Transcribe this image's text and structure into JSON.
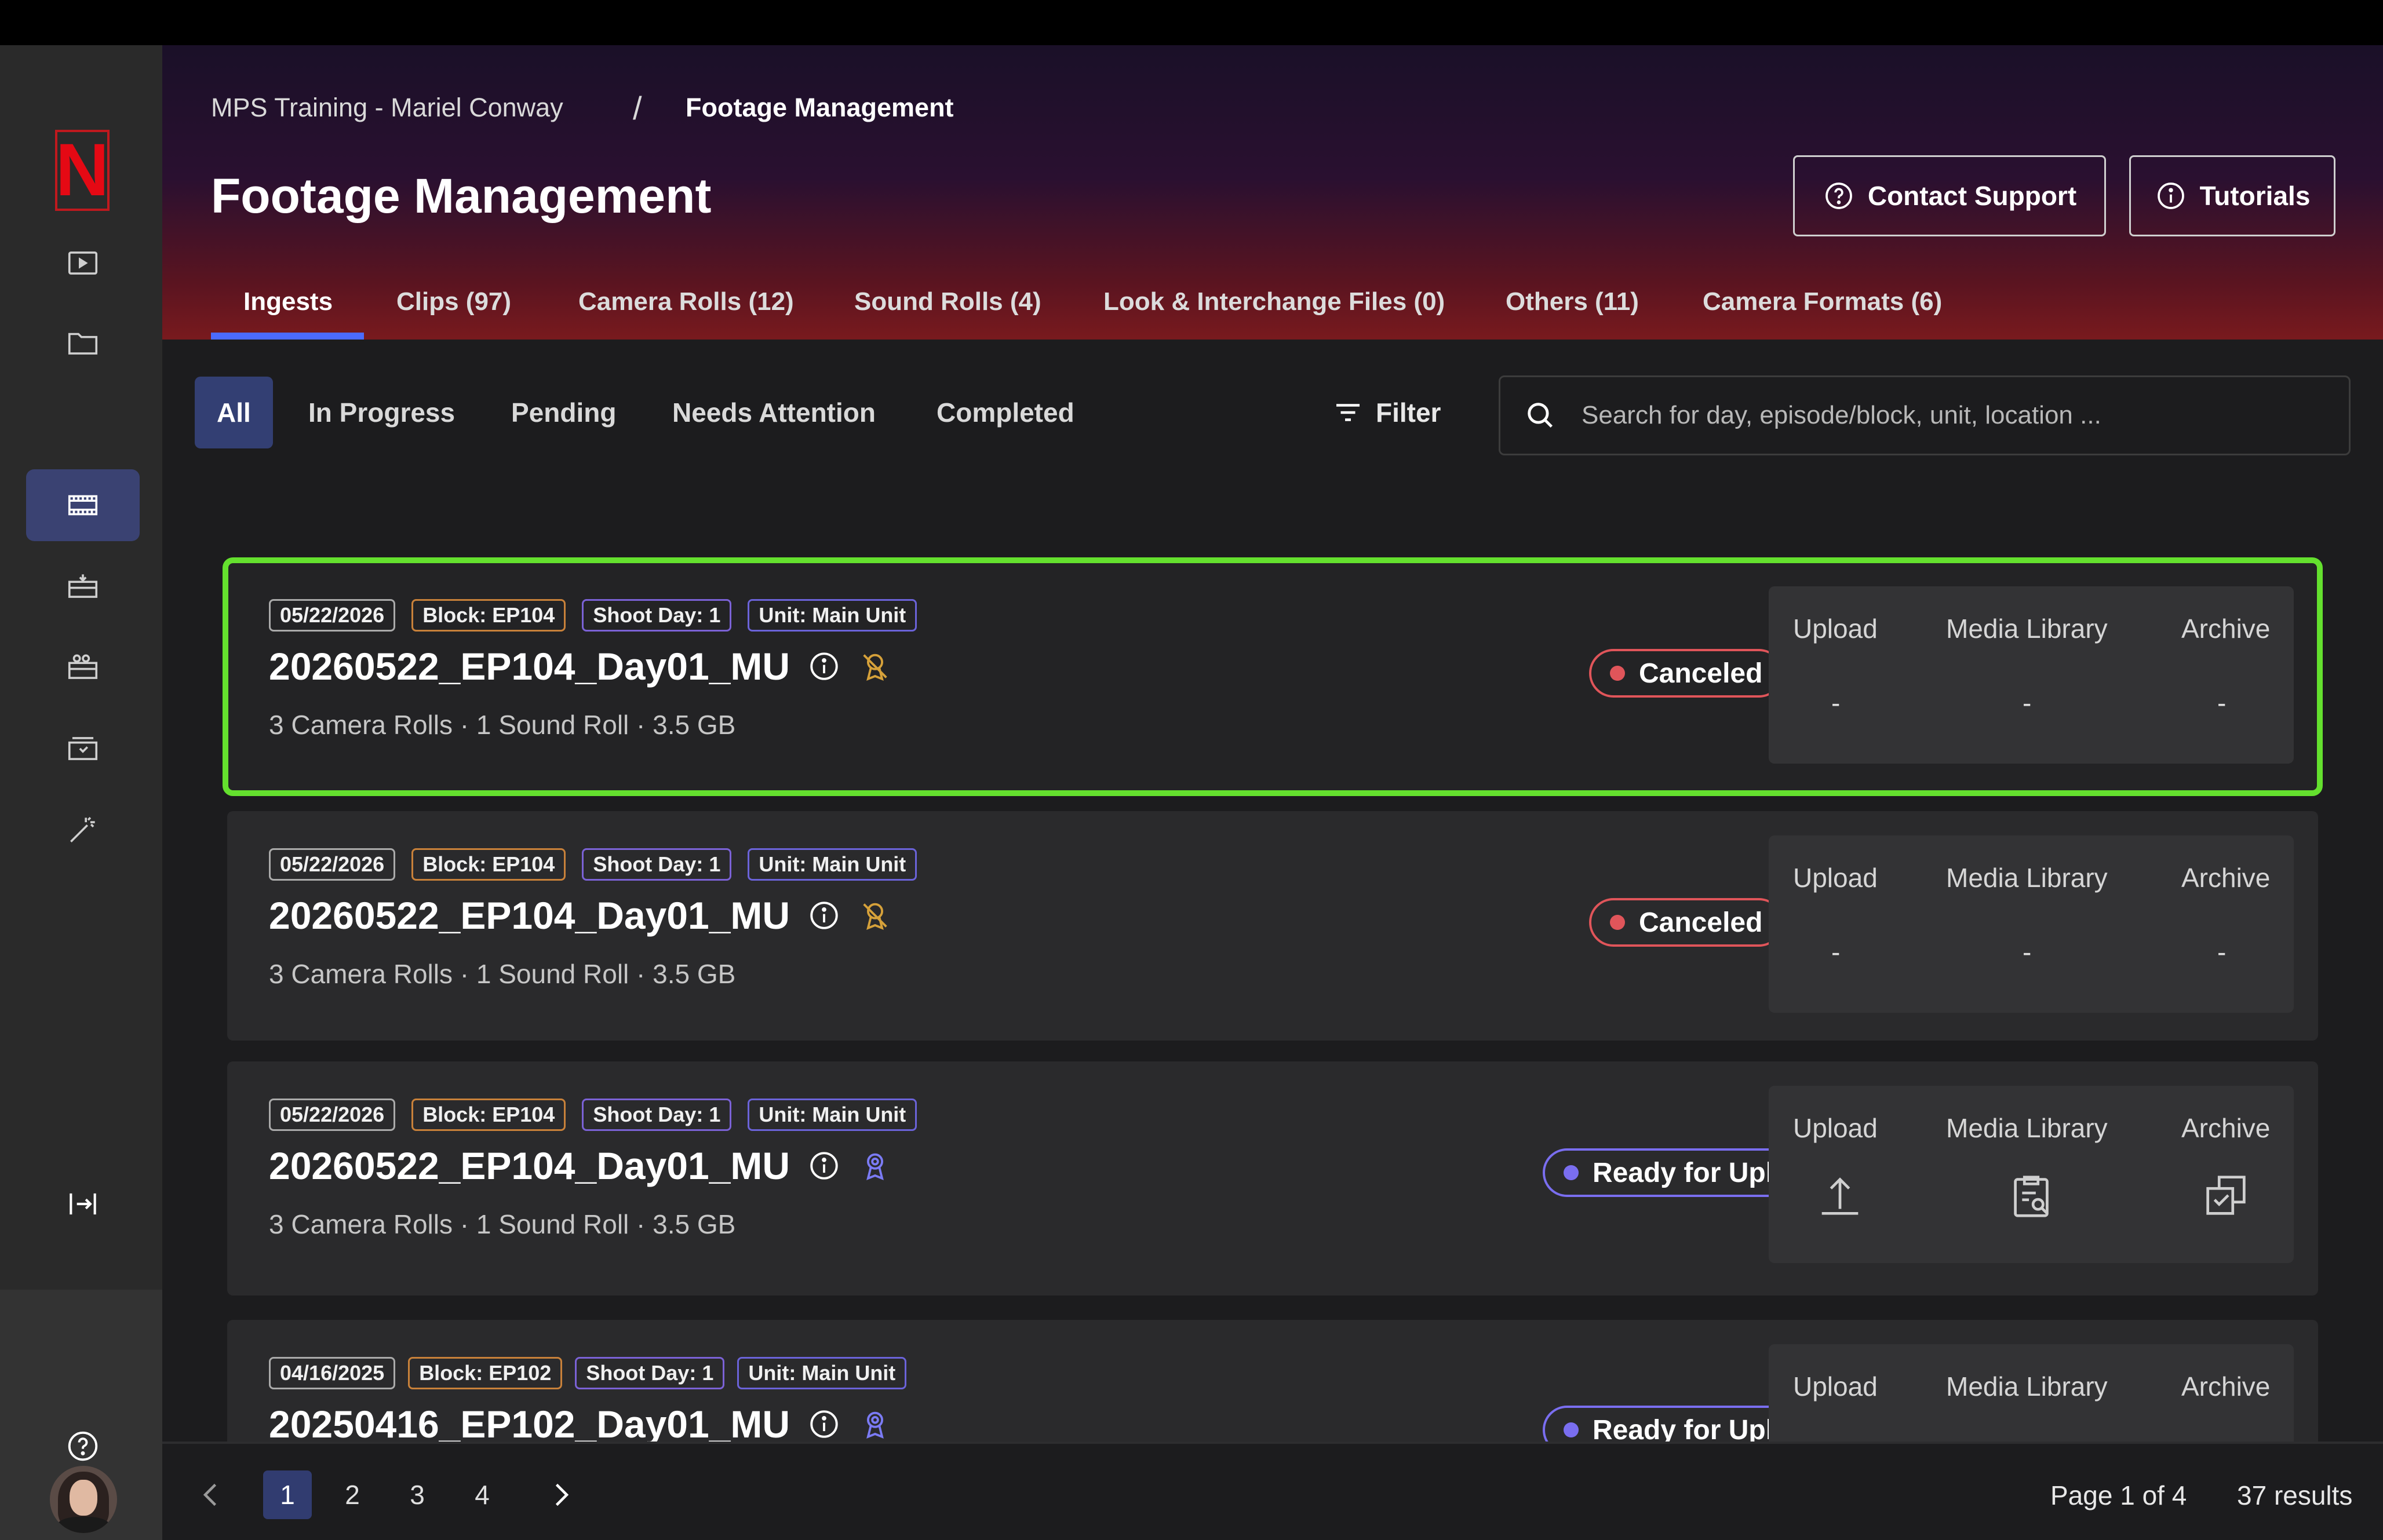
{
  "app": {
    "brand_letter": "N",
    "brand_color": "#e50914",
    "accent": "#64e02e"
  },
  "sidebar": {
    "items": [
      {
        "name": "play-icon"
      },
      {
        "name": "folder-icon"
      },
      {
        "name": "film-icon",
        "active": true
      },
      {
        "name": "camera-roll-icon"
      },
      {
        "name": "camera-icon"
      },
      {
        "name": "archive-icon"
      },
      {
        "name": "magic-wand-icon"
      }
    ],
    "expand_icon": "expand-icon",
    "help_icon": "help-icon"
  },
  "header": {
    "breadcrumb": {
      "parent": "MPS Training - Mariel Conway",
      "separator": "/",
      "current": "Footage Management"
    },
    "title": "Footage Management",
    "contact_support": "Contact Support",
    "tutorials": "Tutorials",
    "tabs": [
      {
        "label": "Ingests",
        "active": true
      },
      {
        "label": "Clips (97)"
      },
      {
        "label": "Camera Rolls (12)"
      },
      {
        "label": "Sound Rolls (4)"
      },
      {
        "label": "Look & Interchange Files (0)"
      },
      {
        "label": "Others (11)"
      },
      {
        "label": "Camera Formats (6)"
      }
    ]
  },
  "filters": {
    "chips": [
      {
        "label": "All",
        "active": true
      },
      {
        "label": "In Progress"
      },
      {
        "label": "Pending"
      },
      {
        "label": "Needs Attention"
      },
      {
        "label": "Completed"
      }
    ],
    "filter_label": "Filter",
    "search_placeholder": "Search for day, episode/block, unit, location ..."
  },
  "columns": {
    "upload": "Upload",
    "media_library": "Media Library",
    "archive": "Archive"
  },
  "ingests": [
    {
      "date": "05/22/2026",
      "block": "Block: EP104",
      "shoot_day": "Shoot Day: 1",
      "unit": "Unit: Main Unit",
      "name": "20260522_EP104_Day01_MU",
      "meta": "3 Camera Rolls · 1 Sound Roll · 3.5 GB",
      "status": "Canceled",
      "status_kind": "canceled",
      "badge_color": "#d6a13a",
      "upload": "-",
      "media_library": "-",
      "archive": "-",
      "selected": true
    },
    {
      "date": "05/22/2026",
      "block": "Block: EP104",
      "shoot_day": "Shoot Day: 1",
      "unit": "Unit: Main Unit",
      "name": "20260522_EP104_Day01_MU",
      "meta": "3 Camera Rolls · 1 Sound Roll · 3.5 GB",
      "status": "Canceled",
      "status_kind": "canceled",
      "badge_color": "#d6a13a",
      "upload": "-",
      "media_library": "-",
      "archive": "-"
    },
    {
      "date": "05/22/2026",
      "block": "Block: EP104",
      "shoot_day": "Shoot Day: 1",
      "unit": "Unit: Main Unit",
      "name": "20260522_EP104_Day01_MU",
      "meta": "3 Camera Rolls · 1 Sound Roll · 3.5 GB",
      "status": "Ready for Upload",
      "status_kind": "ready",
      "badge_color": "#7b7bf5",
      "upload_icon": "upload-icon",
      "media_library_icon": "clipboard-search-icon",
      "archive_icon": "archive-check-icon"
    },
    {
      "date": "04/16/2025",
      "block": "Block: EP102",
      "shoot_day": "Shoot Day: 1",
      "unit": "Unit: Main Unit",
      "name": "20250416_EP102_Day01_MU",
      "status": "Ready for Upload",
      "status_kind": "ready",
      "badge_color": "#7b7bf5"
    }
  ],
  "pagination": {
    "pages": [
      "1",
      "2",
      "3",
      "4"
    ],
    "current": "1",
    "page_info": "Page 1 of 4",
    "results": "37 results"
  },
  "status_colors": {
    "canceled": "#e0555a",
    "ready": "#7a6ef0"
  }
}
